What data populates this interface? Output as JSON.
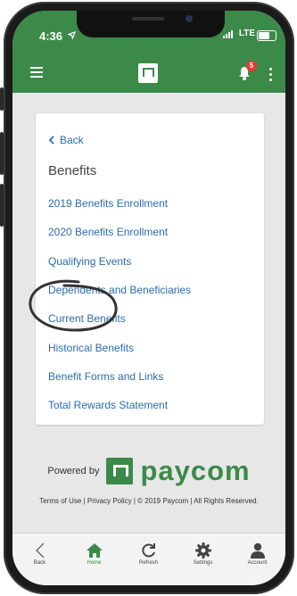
{
  "status": {
    "time": "4:36",
    "network": "LTE"
  },
  "header": {
    "notification_count": "5"
  },
  "nav": {
    "back_label": "Back",
    "section_title": "Benefits",
    "links": [
      "2019 Benefits Enrollment",
      "2020 Benefits Enrollment",
      "Qualifying Events",
      "Dependents and Beneficiaries",
      "Current Benefits",
      "Historical Benefits",
      "Benefit Forms and Links",
      "Total Rewards Statement"
    ]
  },
  "footer": {
    "powered_by": "Powered by",
    "brand": "paycom",
    "legal": "Terms of Use | Privacy Policy | © 2019 Paycom | All Rights Reserved."
  },
  "tabs": [
    {
      "label": "Back",
      "icon": "chevron-left-icon"
    },
    {
      "label": "Home",
      "icon": "home-icon",
      "active": true
    },
    {
      "label": "Refresh",
      "icon": "refresh-icon"
    },
    {
      "label": "Settings",
      "icon": "gear-icon"
    },
    {
      "label": "Account",
      "icon": "person-icon"
    }
  ],
  "colors": {
    "brand_green": "#3b8a49",
    "link_blue": "#2b6cb0",
    "badge_red": "#e53935"
  }
}
